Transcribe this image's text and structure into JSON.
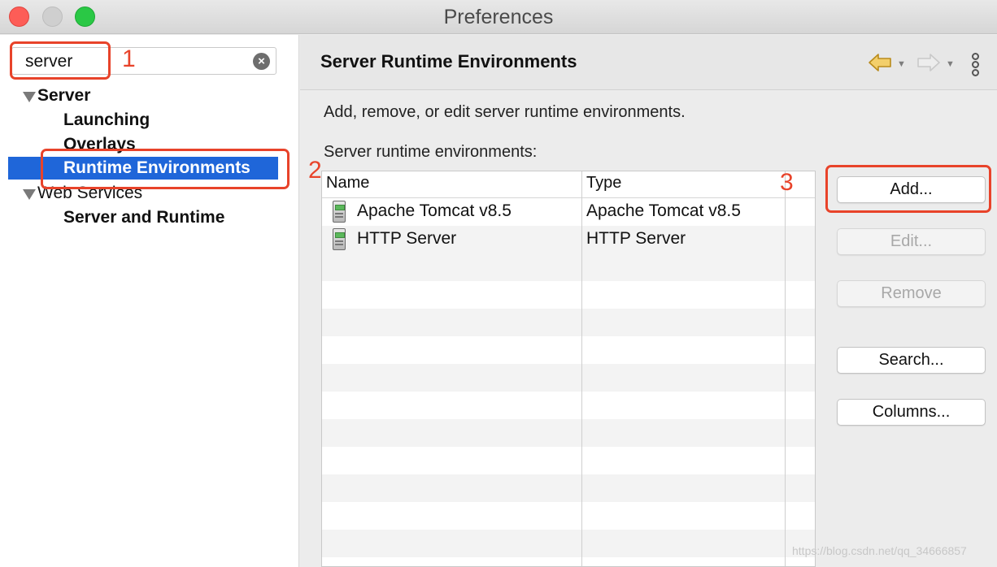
{
  "window": {
    "title": "Preferences"
  },
  "filter": {
    "value": "server"
  },
  "tree": {
    "server": "Server",
    "launching": "Launching",
    "overlays": "Overlays",
    "runtime_environments": "Runtime Environments",
    "web_services": "Web Services",
    "server_and_runtime": "Server and Runtime"
  },
  "page": {
    "title": "Server Runtime Environments",
    "description": "Add, remove, or edit server runtime environments.",
    "list_label": "Server runtime environments:"
  },
  "table": {
    "columns": [
      "Name",
      "Type"
    ],
    "rows": [
      {
        "name": "Apache Tomcat v8.5",
        "type": "Apache Tomcat v8.5"
      },
      {
        "name": "HTTP Server",
        "type": "HTTP Server"
      }
    ]
  },
  "buttons": {
    "add": "Add...",
    "edit": "Edit...",
    "remove": "Remove",
    "search": "Search...",
    "columns": "Columns..."
  },
  "annotations": [
    "1",
    "2",
    "3"
  ],
  "watermark": "https://blog.csdn.net/qq_34666857",
  "colors": {
    "selection": "#1f66d9",
    "annotation": "#e8432a"
  },
  "icons": {
    "clear": "clear-search-icon",
    "back": "back-arrow-icon",
    "forward": "forward-arrow-icon",
    "menu": "view-menu-icon",
    "server": "server-icon"
  }
}
